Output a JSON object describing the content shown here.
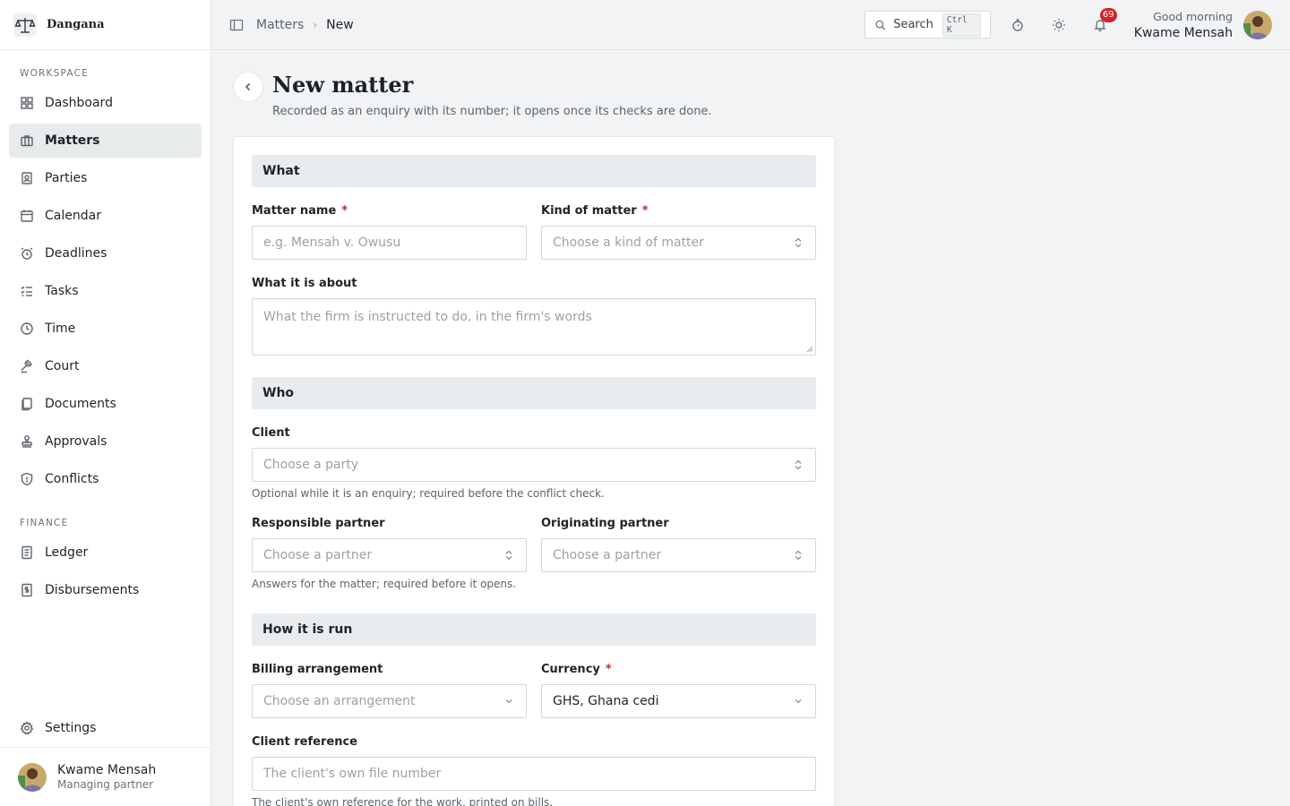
{
  "brand": {
    "name": "Dangana"
  },
  "nav": {
    "workspace_heading": "WORKSPACE",
    "workspace": [
      {
        "label": "Dashboard",
        "icon": "dashboard-icon"
      },
      {
        "label": "Matters",
        "icon": "briefcase-icon",
        "active": true
      },
      {
        "label": "Parties",
        "icon": "contact-icon"
      },
      {
        "label": "Calendar",
        "icon": "calendar-icon"
      },
      {
        "label": "Deadlines",
        "icon": "alarm-icon"
      },
      {
        "label": "Tasks",
        "icon": "list-icon"
      },
      {
        "label": "Time",
        "icon": "clock-icon"
      },
      {
        "label": "Court",
        "icon": "gavel-icon"
      },
      {
        "label": "Documents",
        "icon": "files-icon"
      },
      {
        "label": "Approvals",
        "icon": "stamp-icon"
      },
      {
        "label": "Conflicts",
        "icon": "shield-icon"
      }
    ],
    "finance_heading": "FINANCE",
    "finance": [
      {
        "label": "Ledger",
        "icon": "ledger-icon"
      },
      {
        "label": "Disbursements",
        "icon": "receipt-icon"
      }
    ],
    "settings_label": "Settings"
  },
  "user": {
    "name": "Kwame Mensah",
    "role": "Managing partner"
  },
  "topbar": {
    "breadcrumb": [
      "Matters",
      "New"
    ],
    "search_label": "Search",
    "search_shortcut": "Ctrl K",
    "notifications_count": "69",
    "greeting": "Good morning",
    "greeting_name": "Kwame Mensah"
  },
  "page": {
    "title": "New matter",
    "subtitle": "Recorded as an enquiry with its number; it opens once its checks are done."
  },
  "form": {
    "what": {
      "heading": "What",
      "matter_name_label": "Matter name",
      "matter_name_placeholder": "e.g. Mensah v. Owusu",
      "kind_label": "Kind of matter",
      "kind_placeholder": "Choose a kind of matter",
      "about_label": "What it is about",
      "about_placeholder": "What the firm is instructed to do, in the firm's words"
    },
    "who": {
      "heading": "Who",
      "client_label": "Client",
      "client_placeholder": "Choose a party",
      "client_hint": "Optional while it is an enquiry; required before the conflict check.",
      "responsible_label": "Responsible partner",
      "responsible_placeholder": "Choose a partner",
      "originating_label": "Originating partner",
      "originating_placeholder": "Choose a partner",
      "partner_hint": "Answers for the matter; required before it opens."
    },
    "how": {
      "heading": "How it is run",
      "billing_label": "Billing arrangement",
      "billing_placeholder": "Choose an arrangement",
      "currency_label": "Currency",
      "currency_value": "GHS, Ghana cedi",
      "client_ref_label": "Client reference",
      "client_ref_placeholder": "The client's own file number",
      "client_ref_hint": "The client's own reference for the work, printed on bills."
    },
    "required_mark": "*"
  },
  "colors": {
    "accent_badge": "#d0222a",
    "required": "#c62a2a",
    "section_bg": "#e9ecee"
  }
}
